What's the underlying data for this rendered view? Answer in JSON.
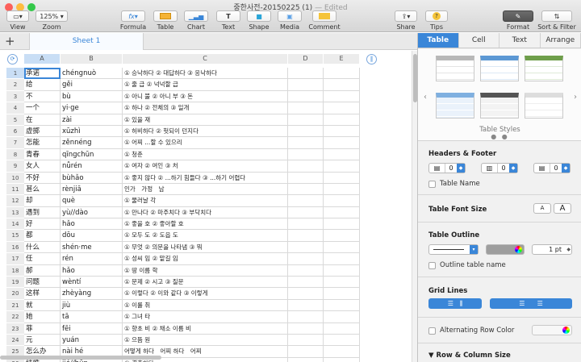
{
  "window": {
    "title": "중한사전-20150225 (1)",
    "edited": "— Edited"
  },
  "toolbar": {
    "view": "View",
    "zoom_value": "125%",
    "zoom": "Zoom",
    "formula": "Formula",
    "table": "Table",
    "chart": "Chart",
    "text": "Text",
    "shape": "Shape",
    "media": "Media",
    "comment": "Comment",
    "share": "Share",
    "tips": "Tips",
    "format": "Format",
    "sort_filter": "Sort & Filter"
  },
  "sheet": {
    "add": "+",
    "tab": "Sheet 1"
  },
  "columns": [
    "A",
    "B",
    "C",
    "D",
    "E"
  ],
  "rows": [
    {
      "n": "1",
      "a": "承诺",
      "b": "chéngnuò",
      "c": "① 승낙하다 ② 대답하다 ③ 응낙하다"
    },
    {
      "n": "2",
      "a": "给",
      "b": "gěi",
      "c": "① 줄 급 ② 넉넉할 급"
    },
    {
      "n": "3",
      "a": "不",
      "b": "bù",
      "c": "① 아니 불 ② 아니 부 ③ 돈"
    },
    {
      "n": "4",
      "a": "一个",
      "b": "yi·ge",
      "c": "① 하나 ② 전체의 ③ 일개"
    },
    {
      "n": "5",
      "a": "在",
      "b": "zài",
      "c": "① 있을 재"
    },
    {
      "n": "6",
      "a": "虚掷",
      "b": "xūzhì",
      "c": "① 허비하다 ② 헛되이 던지다"
    },
    {
      "n": "7",
      "a": "怎能",
      "b": "zěnnéng",
      "c": "① 어찌 ...할 수 있으리"
    },
    {
      "n": "8",
      "a": "青春",
      "b": "qīngchūn",
      "c": "① 청춘"
    },
    {
      "n": "9",
      "a": "女人",
      "b": "nǚrén",
      "c": "① 여자 ② 여인 ③ 처"
    },
    {
      "n": "10",
      "a": "不好",
      "b": "bùhǎo",
      "c": "① 좋지 않다 ② ...하기 힘들다 ③ ...하기 어렵다"
    },
    {
      "n": "11",
      "a": "甚么",
      "b": "rènjiā",
      "c": "인가　가정　남"
    },
    {
      "n": "12",
      "a": "却",
      "b": "què",
      "c": "① 물러날 각"
    },
    {
      "n": "13",
      "a": "遇到",
      "b": "yù//dào",
      "c": "① 만나다 ② 마주치다 ③ 부닥치다"
    },
    {
      "n": "14",
      "a": "好",
      "b": "hǎo",
      "c": "① 좋을 호 ② 좋아할 호"
    },
    {
      "n": "15",
      "a": "都",
      "b": "dōu",
      "c": "① 모두 도 ② 도읍 도"
    },
    {
      "n": "16",
      "a": "什么",
      "b": "shén·me",
      "c": "① 무엇 ② 의문을 나타냄 ③ 뭐"
    },
    {
      "n": "17",
      "a": "任",
      "b": "rén",
      "c": "① 성씨 임 ② 맡길 임"
    },
    {
      "n": "18",
      "a": "郝",
      "b": "hǎo",
      "c": "① 땅 이름 학"
    },
    {
      "n": "19",
      "a": "问题",
      "b": "wèntí",
      "c": "① 문제 ② 시고 ③ 질문"
    },
    {
      "n": "20",
      "a": "这样",
      "b": "zhèyàng",
      "c": "① 이렇다 ② 이와 같다 ③ 이렇게"
    },
    {
      "n": "21",
      "a": "就",
      "b": "jiù",
      "c": "① 이룰 취"
    },
    {
      "n": "22",
      "a": "她",
      "b": "tā",
      "c": "① 그녀 타"
    },
    {
      "n": "23",
      "a": "菲",
      "b": "fēi",
      "c": "① 향초 비 ② 채소 이름 비"
    },
    {
      "n": "24",
      "a": "元",
      "b": "yuán",
      "c": "① 으뜸 원"
    },
    {
      "n": "25",
      "a": "怎么办",
      "b": "nài hé",
      "c": "어떻게 하다　어찌 하다　어찌"
    },
    {
      "n": "26",
      "a": "结婚",
      "b": "jié//hūn",
      "c": "① 결혼하다"
    }
  ],
  "inspector": {
    "tabs": [
      "Table",
      "Cell",
      "Text",
      "Arrange"
    ],
    "table_styles": "Table Styles",
    "headers_footer": "Headers & Footer",
    "hf_values": [
      "0",
      "0",
      "0"
    ],
    "table_name": "Table Name",
    "table_font_size": "Table Font Size",
    "font_small": "A",
    "font_large": "A",
    "table_outline": "Table Outline",
    "outline_width": "1 pt",
    "outline_table_name": "Outline table name",
    "grid_lines": "Grid Lines",
    "alternating_row_color": "Alternating Row Color",
    "row_column_size": "Row & Column Size"
  },
  "colors": {
    "accent": "#3a86d8",
    "toolbar": "#d9d9d9",
    "selection": "#c9def5"
  }
}
